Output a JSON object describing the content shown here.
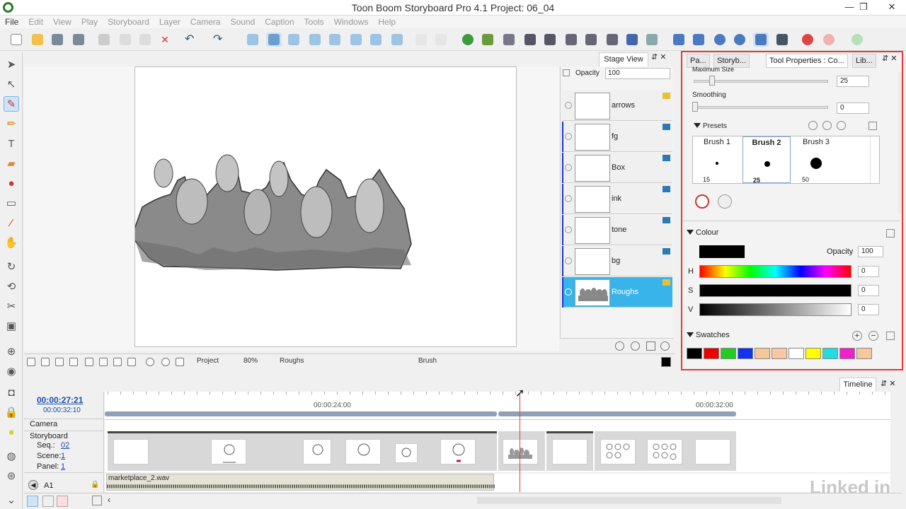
{
  "window": {
    "title": "Toon Boom Storyboard Pro 4.1 Project: 06_04",
    "min": "—",
    "max": "❐",
    "close": "✕"
  },
  "menu": [
    "File",
    "Edit",
    "View",
    "Play",
    "Storyboard",
    "Layer",
    "Camera",
    "Sound",
    "Caption",
    "Tools",
    "Windows",
    "Help"
  ],
  "stage": {
    "tab": "Stage View",
    "opacity_label": "Opacity",
    "opacity_value": "100",
    "bottom": {
      "view_mode": "Project",
      "zoom": "80%",
      "layer": "Roughs",
      "tool": "Brush"
    }
  },
  "layers": [
    {
      "name": "arrows"
    },
    {
      "name": "fg"
    },
    {
      "name": "Box"
    },
    {
      "name": "ink"
    },
    {
      "name": "tone"
    },
    {
      "name": "bg"
    },
    {
      "name": "Roughs",
      "selected": true
    }
  ],
  "right_panel": {
    "tabs": [
      "Pa...",
      "Storyb...",
      "Tool Properties : Co...",
      "Lib..."
    ],
    "max_size_label": "Maximum Size",
    "max_size_value": "25",
    "smoothing_label": "Smoothing",
    "smoothing_value": "0",
    "presets_label": "Presets",
    "presets": [
      {
        "name": "Brush 1",
        "size": "15"
      },
      {
        "name": "Brush 2",
        "size": "25"
      },
      {
        "name": "Brush 3",
        "size": "50"
      }
    ],
    "colour_label": "Colour",
    "colour_opacity_label": "Opacity",
    "colour_opacity": "100",
    "h_label": "H",
    "h_value": "0",
    "s_label": "S",
    "s_value": "0",
    "v_label": "V",
    "v_value": "0",
    "swatches_label": "Swatches",
    "swatch_colors": [
      "#000000",
      "#ee0000",
      "#22cc22",
      "#1133ee",
      "#f5c89a",
      "#f8c8a0",
      "#ffffff",
      "#ffff00",
      "#22dddd",
      "#ee22cc",
      "#f5c8a0"
    ]
  },
  "timeline": {
    "tab": "Timeline",
    "current_time": "00:00:27:21",
    "total_time": "00:00:32:10",
    "ruler_marks": [
      "00:00:24:00",
      "00:00:32:00"
    ],
    "camera_label": "Camera",
    "storyboard_label": "Storyboard",
    "seq_label": "Seq.:",
    "seq_value": "02",
    "scene_label": "Scene:",
    "scene_value": "1",
    "panel_label": "Panel:",
    "panel_value": "1",
    "audio_track": "A1",
    "audio_clip": "marketplace_2.wav"
  },
  "watermark": "Linked in"
}
